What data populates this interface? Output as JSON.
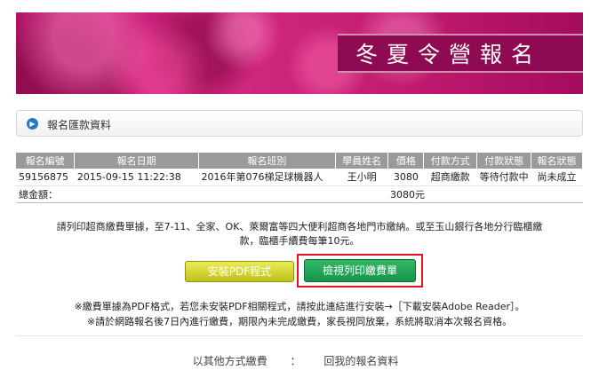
{
  "banner": {
    "title": "冬夏令營報名"
  },
  "section": {
    "icon": "arrow-right-circle-icon",
    "title": "報名匯款資料"
  },
  "table": {
    "headers": [
      "報名編號",
      "報名日期",
      "報名班別",
      "學員姓名",
      "價格",
      "付款方式",
      "付款狀態",
      "報名狀態"
    ],
    "row": {
      "id": "59156875",
      "date": "2015-09-15 11:22:38",
      "course": "2016年第076梯足球機器人",
      "student": "王小明",
      "price": "3080",
      "payment_method": "超商繳款",
      "payment_status": "等待付款中",
      "registration_status": "尚未成立"
    },
    "total_label": "總金額：",
    "total_value": "3080元"
  },
  "notice": {
    "line1": "請列印超商繳費單據，至7-11、全家、OK、萊爾富等四大便利超商各地門市繳納。或至玉山銀行各地分行臨櫃繳",
    "line2": "款，臨櫃手續費每筆10元。"
  },
  "buttons": {
    "install_pdf": "安裝PDF程式",
    "view_print": "檢視列印繳費單"
  },
  "notes": {
    "line1_prefix": "※繳費單據為PDF格式，若您未安裝PDF相關程式，請按此連結進行安裝→",
    "line1_link": "［下載安裝Adobe Reader］。",
    "line2": "※請於網路報名後7日內進行繳費，期限內未完成繳費，家長視同放棄，系統將取消本次報名資格。"
  },
  "footer": {
    "other_payment": "以其他方式繳費",
    "separator": "：",
    "my_registration": "回我的報名資料"
  },
  "colors": {
    "banner": "#c01a6f",
    "table_header": "#9a9a9a",
    "pdf_button": "#d4d62a",
    "print_button": "#1fa456",
    "highlight": "#e0141e",
    "section_icon": "#2a78c2"
  }
}
